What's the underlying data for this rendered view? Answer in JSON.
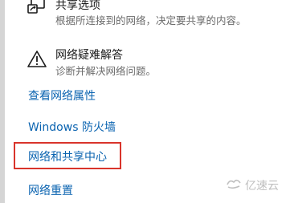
{
  "options": [
    {
      "title": "共享选项",
      "description": "根据所连接到的网络，决定要共享的内容。",
      "icon": "sharing-icon"
    },
    {
      "title": "网络疑难解答",
      "description": "诊断并解决网络问题。",
      "icon": "warning-icon"
    }
  ],
  "links": {
    "view_properties": "查看网络属性",
    "firewall": "Windows 防火墙",
    "network_sharing_center": "网络和共享中心",
    "network_reset": "网络重置"
  },
  "watermark": {
    "text": "亿速云",
    "icon": "yisuyun-logo-icon"
  },
  "colors": {
    "link": "#0a63b0",
    "highlight_border": "#d9342b"
  }
}
